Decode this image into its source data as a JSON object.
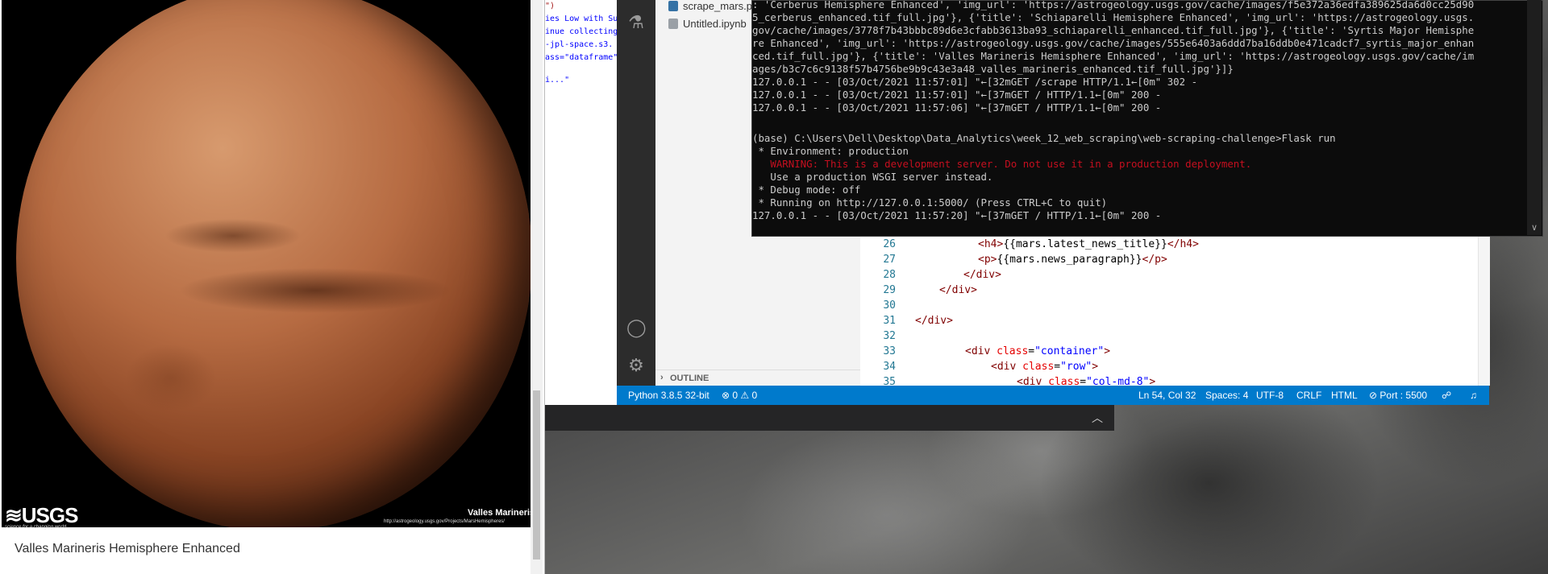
{
  "browser": {
    "hemisphere_title": "Valles Marineris Hemisphere Enhanced",
    "image": {
      "logo_text": "≋USGS",
      "logo_tagline": "science for a changing world",
      "caption": "Valles Marineris",
      "url_caption": "http://astrogeology.usgs.gov/Projects/MarsHemispheres/"
    }
  },
  "editor_peek": {
    "lines": [
      "\")",
      "ies Low with Su",
      "inue collecting",
      "-jpl-space.s3.",
      "ass=\"dataframe\"",
      "",
      "i...\""
    ]
  },
  "vscode": {
    "explorer": {
      "files": [
        "scrape_mars.py",
        "Untitled.ipynb"
      ],
      "outline_label": "OUTLINE"
    },
    "code": {
      "line_numbers": [
        "26",
        "27",
        "28",
        "29",
        "30",
        "31",
        "32",
        "33",
        "34",
        "35"
      ]
    },
    "statusbar": {
      "interpreter": "Python 3.8.5 32-bit",
      "problems": "⊗ 0 ⚠ 0",
      "cursor": "Ln 54, Col 32",
      "spaces": "Spaces: 4",
      "encoding": "UTF-8",
      "eol": "CRLF",
      "language": "HTML",
      "port": "⊘ Port : 5500"
    }
  },
  "terminal": {
    "lines": [
      ": 'Cerberus Hemisphere Enhanced', 'img_url': 'https://astrogeology.usgs.gov/cache/images/f5e372a36edfa389625da6d0cc25d90",
      "5_cerberus_enhanced.tif_full.jpg'}, {'title': 'Schiaparelli Hemisphere Enhanced', 'img_url': 'https://astrogeology.usgs.",
      "gov/cache/images/3778f7b43bbbc89d6e3cfabb3613ba93_schiaparelli_enhanced.tif_full.jpg'}, {'title': 'Syrtis Major Hemisphe",
      "re Enhanced', 'img_url': 'https://astrogeology.usgs.gov/cache/images/555e6403a6ddd7ba16ddb0e471cadcf7_syrtis_major_enhan",
      "ced.tif_full.jpg'}, {'title': 'Valles Marineris Hemisphere Enhanced', 'img_url': 'https://astrogeology.usgs.gov/cache/im",
      "ages/b3c7c6c9138f57b4756be9b9c43e3a48_valles_marineris_enhanced.tif_full.jpg'}]}",
      "127.0.0.1 - - [03/Oct/2021 11:57:01] \"←[32mGET /scrape HTTP/1.1←[0m\" 302 -",
      "127.0.0.1 - - [03/Oct/2021 11:57:01] \"←[37mGET / HTTP/1.1←[0m\" 200 -",
      "127.0.0.1 - - [03/Oct/2021 11:57:06] \"←[37mGET / HTTP/1.1←[0m\" 200 -",
      "",
      "(base) C:\\Users\\Dell\\Desktop\\Data_Analytics\\week_12_web_scraping\\web-scraping-challenge>Flask run",
      " * Environment: production",
      "   WARNING: This is a development server. Do not use it in a production deployment.",
      "   Use a production WSGI server instead.",
      " * Debug mode: off",
      " * Running on http://127.0.0.1:5000/ (Press CTRL+C to quit)",
      "127.0.0.1 - - [03/Oct/2021 11:57:20] \"←[37mGET / HTTP/1.1←[0m\" 200 -"
    ]
  }
}
